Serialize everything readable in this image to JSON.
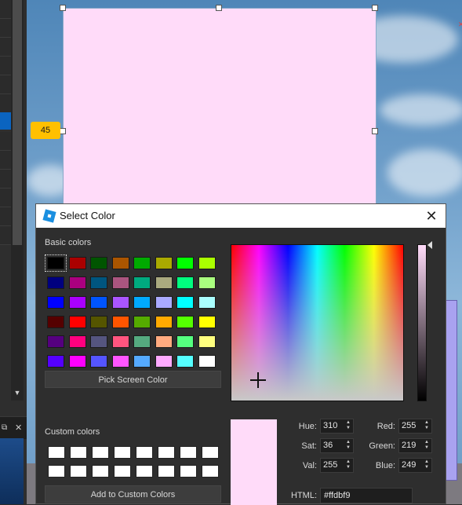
{
  "app": {
    "rotation_badge": "45"
  },
  "dialog": {
    "title": "Select Color",
    "close_glyph": "✕",
    "basic_colors_label": "Basic colors",
    "pick_screen_label": "Pick Screen Color",
    "custom_colors_label": "Custom colors",
    "add_custom_label": "Add to Custom Colors",
    "basic_colors": [
      "#000000",
      "#aa0000",
      "#005500",
      "#aa5500",
      "#00aa00",
      "#aaaa00",
      "#00ff00",
      "#aaff00",
      "#00007f",
      "#aa007f",
      "#00557f",
      "#aa557f",
      "#00aa7f",
      "#aaaa7f",
      "#00ff7f",
      "#aaff7f",
      "#0000ff",
      "#aa00ff",
      "#0055ff",
      "#aa55ff",
      "#00aaff",
      "#aaaaff",
      "#00ffff",
      "#aaffff",
      "#550000",
      "#ff0000",
      "#555500",
      "#ff5500",
      "#55aa00",
      "#ffaa00",
      "#55ff00",
      "#ffff00",
      "#55007f",
      "#ff007f",
      "#55557f",
      "#ff557f",
      "#55aa7f",
      "#ffaa7f",
      "#55ff7f",
      "#ffff7f",
      "#5500ff",
      "#ff00ff",
      "#5555ff",
      "#ff55ff",
      "#55aaff",
      "#ffaaff",
      "#55ffff",
      "#ffffff"
    ],
    "selected_color": "#ffdbf9",
    "fields": {
      "hue_label": "Hue:",
      "hue": "310",
      "sat_label": "Sat:",
      "sat": "36",
      "val_label": "Val:",
      "val": "255",
      "red_label": "Red:",
      "red": "255",
      "green_label": "Green:",
      "green": "219",
      "blue_label": "Blue:",
      "blue": "249",
      "html_label": "HTML:",
      "html": "#ffdbf9"
    }
  }
}
